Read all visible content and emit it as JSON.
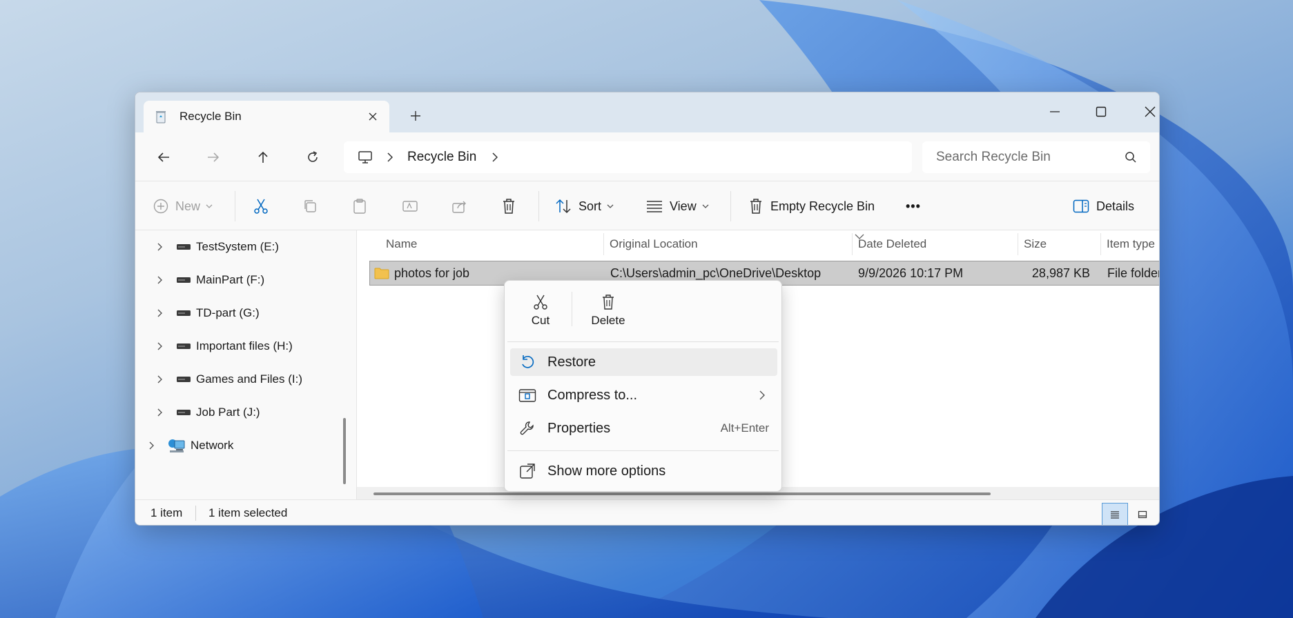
{
  "window": {
    "tab_title": "Recycle Bin",
    "controls": {
      "minimize": "minimize-icon",
      "maximize": "maximize-icon",
      "close": "close-icon"
    }
  },
  "address_bar": {
    "breadcrumb": [
      "Recycle Bin"
    ],
    "search_placeholder": "Search Recycle Bin"
  },
  "toolbar": {
    "new_label": "New",
    "sort_label": "Sort",
    "view_label": "View",
    "empty_label": "Empty Recycle Bin",
    "more_label": "•••",
    "details_label": "Details"
  },
  "sidebar": {
    "items": [
      {
        "label": "TestSystem (E:)",
        "icon": "drive-icon"
      },
      {
        "label": "MainPart (F:)",
        "icon": "drive-icon"
      },
      {
        "label": "TD-part (G:)",
        "icon": "drive-icon"
      },
      {
        "label": "Important files (H:)",
        "icon": "drive-icon"
      },
      {
        "label": "Games and Files (I:)",
        "icon": "drive-icon"
      },
      {
        "label": "Job Part (J:)",
        "icon": "drive-icon"
      },
      {
        "label": "Network",
        "icon": "network-icon"
      }
    ]
  },
  "columns": {
    "name": "Name",
    "original_location": "Original Location",
    "date_deleted": "Date Deleted",
    "size": "Size",
    "item_type": "Item type"
  },
  "rows": [
    {
      "name": "photos for job",
      "original_location": "C:\\Users\\admin_pc\\OneDrive\\Desktop",
      "date_deleted": "9/9/2026 10:17 PM",
      "size": "28,987 KB",
      "item_type": "File folder"
    }
  ],
  "status": {
    "count": "1 item",
    "selected": "1 item selected"
  },
  "context_menu": {
    "cut": "Cut",
    "delete": "Delete",
    "restore": "Restore",
    "compress": "Compress to...",
    "properties": "Properties",
    "properties_shortcut": "Alt+Enter",
    "more_options": "Show more options"
  },
  "colors": {
    "accent": "#0067c0",
    "selection": "#cccccc",
    "titlebar": "#dce6f0"
  }
}
